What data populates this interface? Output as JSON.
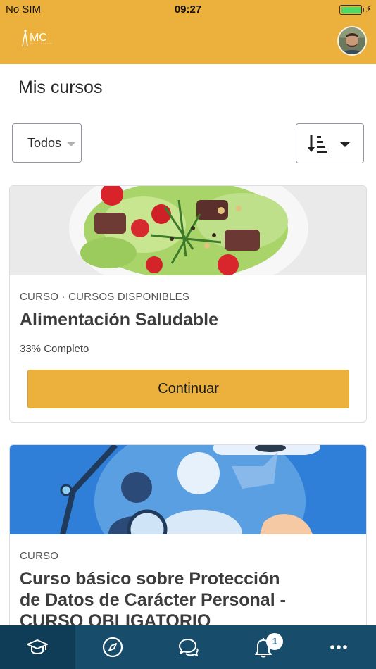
{
  "status_bar": {
    "carrier": "No SIM",
    "time": "09:27",
    "battery_level": 1.0,
    "charging_icon": "bolt-icon"
  },
  "header": {
    "logo_text": "MC",
    "avatar_icon": "user-avatar",
    "color": "#ecb13c"
  },
  "page": {
    "title": "Mis cursos"
  },
  "filters": {
    "category_selected": "Todos",
    "sort_icon": "sort-descending-icon",
    "sort_caret_icon": "caret-down-icon"
  },
  "courses": [
    {
      "meta": "CURSO · CURSOS DISPONIBLES",
      "title": "Alimentación Saludable",
      "progress_text": "33% Completo",
      "progress": 0.33,
      "button_label": "Continuar",
      "image": "salad-photo"
    },
    {
      "meta": "CURSO",
      "title_lines": [
        "Curso básico sobre Protección",
        "de Datos de Carácter Personal -",
        "CURSO OBLIGATORIO"
      ],
      "image": "data-protection-illustration"
    }
  ],
  "bottom_nav": {
    "items": [
      {
        "icon": "graduation-cap-icon",
        "active": true
      },
      {
        "icon": "compass-icon",
        "active": false
      },
      {
        "icon": "chat-bubbles-icon",
        "active": false
      },
      {
        "icon": "bell-icon",
        "active": false,
        "badge": "1"
      },
      {
        "icon": "more-dots-icon",
        "active": false
      }
    ],
    "color": "#174d6b",
    "active_color": "#0f3d57"
  }
}
